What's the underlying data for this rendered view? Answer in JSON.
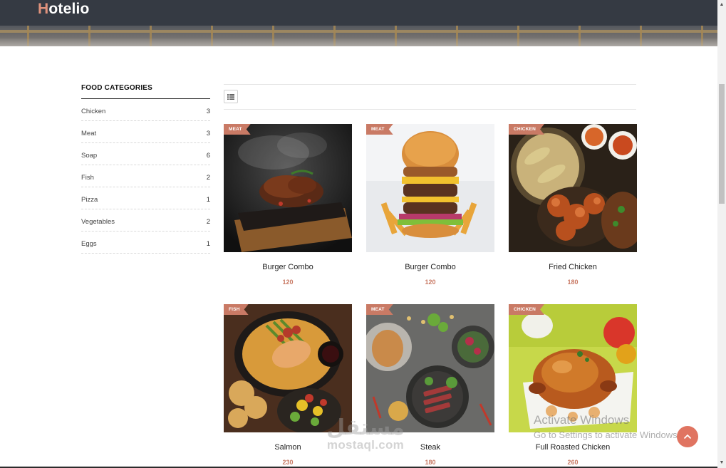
{
  "header": {
    "logo_first": "H",
    "logo_rest": "otelio"
  },
  "sidebar": {
    "title": "FOOD CATEGORIES",
    "categories": [
      {
        "label": "Chicken",
        "count": "3"
      },
      {
        "label": "Meat",
        "count": "3"
      },
      {
        "label": "Soap",
        "count": "6"
      },
      {
        "label": "Fish",
        "count": "2"
      },
      {
        "label": "Pizza",
        "count": "1"
      },
      {
        "label": "Vegetables",
        "count": "2"
      },
      {
        "label": "Eggs",
        "count": "1"
      }
    ]
  },
  "toolbar": {
    "view_icon": "list-view-icon"
  },
  "products": [
    {
      "tag": "MEAT",
      "name": "Burger Combo",
      "price": "120"
    },
    {
      "tag": "MEAT",
      "name": "Burger Combo",
      "price": "120"
    },
    {
      "tag": "CHICKEN",
      "name": "Fried Chicken",
      "price": "180"
    },
    {
      "tag": "FISH",
      "name": "Salmon",
      "price": "230"
    },
    {
      "tag": "MEAT",
      "name": "Steak",
      "price": "180"
    },
    {
      "tag": "CHICKEN",
      "name": "Full Roasted Chicken",
      "price": "260"
    }
  ],
  "overlays": {
    "watermark_arabic": "مستقل",
    "watermark_latin": "mostaql.com",
    "activate_line1": "Activate Windows",
    "activate_line2": "Go to Settings to activate Windows."
  },
  "colors": {
    "header_bg": "#353a43",
    "accent": "#c97a65",
    "back_to_top": "#e07461"
  }
}
